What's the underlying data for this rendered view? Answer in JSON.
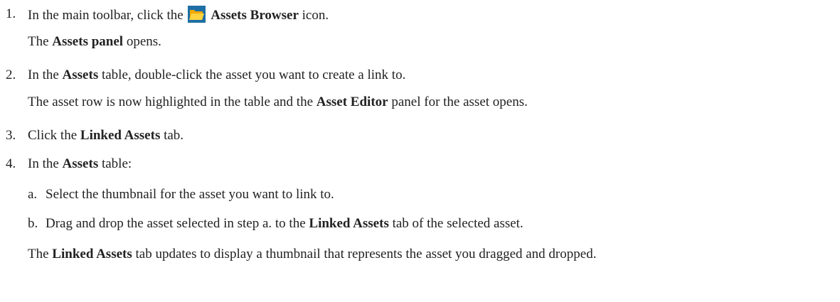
{
  "steps": [
    {
      "num": "1.",
      "pre": "In the main toolbar, click the",
      "icon": "folder-icon",
      "bold": "Assets Browser",
      "post": "icon.",
      "result_pre": "The",
      "result_bold": "Assets panel",
      "result_post": "opens."
    },
    {
      "num": "2.",
      "pre": "In the",
      "bold": "Assets",
      "post": "table, double-click the asset you want to create a link to.",
      "result_pre": "The asset row is now highlighted in the table and the",
      "result_bold": "Asset Editor",
      "result_post": "panel for the asset opens."
    },
    {
      "num": "3.",
      "pre": "Click the",
      "bold": "Linked Assets",
      "post": "tab."
    },
    {
      "num": "4.",
      "pre": "In the",
      "bold": "Assets",
      "post": "table:",
      "substeps": [
        {
          "letter": "a.",
          "text": "Select the thumbnail for the asset you want to link to."
        },
        {
          "letter": "b.",
          "pre": "Drag and drop the asset selected in step a. to the",
          "bold": "Linked Assets",
          "post": "tab of the selected asset."
        }
      ],
      "result_pre": "The",
      "result_bold": "Linked Assets",
      "result_post": "tab updates to display a thumbnail that represents the asset you dragged and dropped."
    }
  ],
  "colors": {
    "text": "#222222",
    "folder_body": "#f2a900",
    "folder_front": "#ffd23f",
    "folder_dark": "#1d6fa5"
  }
}
